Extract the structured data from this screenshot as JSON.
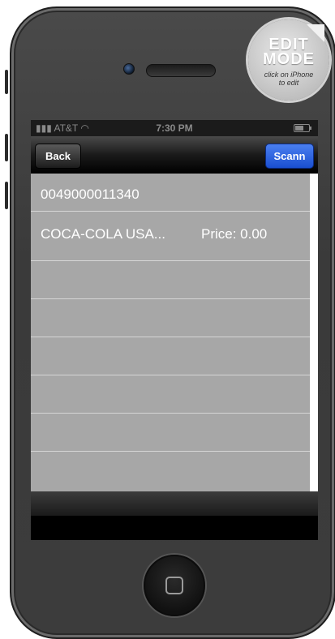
{
  "status_bar": {
    "carrier": "AT&T",
    "time": "7:30 PM"
  },
  "nav": {
    "back_label": "Back",
    "scan_label": "Scann"
  },
  "table": {
    "rows": [
      {
        "text": "0049000011340"
      },
      {
        "name": "COCA-COLA USA...",
        "price": "Price: 0.00"
      }
    ]
  },
  "badge": {
    "line1": "EDIT",
    "line2": "MODE",
    "hint1": "click on iPhone",
    "hint2": "to edit"
  },
  "colors": {
    "table_bg": "#a7a7a7",
    "scan_button": "#2a5fe0",
    "phone_body": "#3c3c3c"
  }
}
